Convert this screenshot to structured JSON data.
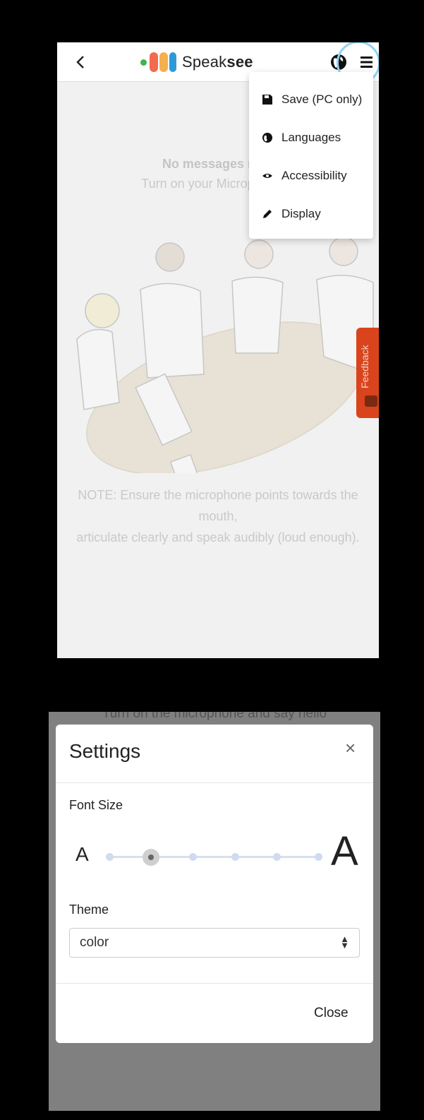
{
  "header": {
    "brand_prefix": "Speak",
    "brand_suffix": "see",
    "logo_colors": [
      "#3cb54a",
      "#f26b4f",
      "#f4b04f",
      "#2d9ad6"
    ]
  },
  "menu": {
    "items": [
      {
        "label": "Save (PC only)",
        "icon": "save-icon"
      },
      {
        "label": "Languages",
        "icon": "globe-icon"
      },
      {
        "label": "Accessibility",
        "icon": "eye-icon"
      },
      {
        "label": "Display",
        "icon": "pencil-icon"
      }
    ]
  },
  "empty_state": {
    "title": "No messages rece",
    "subtitle": "Turn on your Microphone K",
    "note_line1": "NOTE: Ensure the microphone points towards the",
    "note_line2": "mouth,",
    "note_line3": "articulate clearly and speak audibly (loud enough)."
  },
  "feedback": {
    "label": "Feedback",
    "color": "#d9441c"
  },
  "settings": {
    "background_text": "Turn on the microphone and say hello",
    "title": "Settings",
    "close_x": "×",
    "font_size_label": "Font Size",
    "small_a": "A",
    "large_a": "A",
    "font_size_steps": 6,
    "font_size_selected_index": 1,
    "theme_label": "Theme",
    "theme_value": "color",
    "close_label": "Close"
  }
}
